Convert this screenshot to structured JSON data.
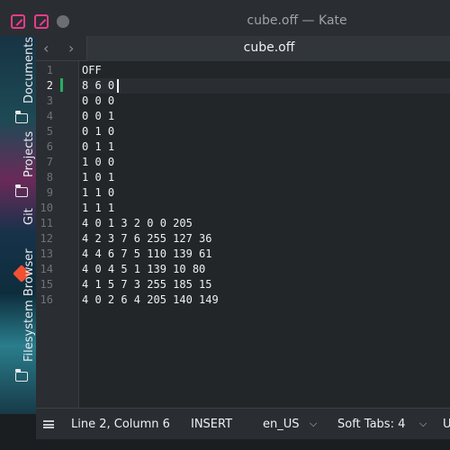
{
  "window": {
    "title": "cube.off — Kate"
  },
  "sidebar": {
    "items": [
      {
        "label": "Documents"
      },
      {
        "label": "Projects"
      },
      {
        "label": "Git"
      },
      {
        "label": "Filesystem Browser"
      }
    ]
  },
  "tabbar": {
    "back": "‹",
    "forward": "›",
    "tab_label": "cube.off"
  },
  "editor": {
    "current_line": 2,
    "line_numbers": [
      "1",
      "2",
      "3",
      "4",
      "5",
      "6",
      "7",
      "8",
      "9",
      "10",
      "11",
      "12",
      "13",
      "14",
      "15",
      "16"
    ],
    "lines": [
      "OFF",
      "8 6 0",
      "0 0 0",
      "0 0 1",
      "0 1 0",
      "0 1 1",
      "1 0 0",
      "1 0 1",
      "1 1 0",
      "1 1 1",
      "4 0 1 3 2 0 0 205",
      "4 2 3 7 6 255 127 36",
      "4 4 6 7 5 110 139 61",
      "4 0 4 5 1 139 10 80",
      "4 1 5 7 3 255 185 15",
      "4 0 2 6 4 205 140 149"
    ]
  },
  "statusbar": {
    "cursor_position": "Line 2, Column 6",
    "mode": "INSERT",
    "dictionary": "en_US",
    "indent": "Soft Tabs: 4",
    "encoding_partial": "U"
  },
  "colors": {
    "accent_pink": "#e93d8a",
    "git_orange": "#f05133",
    "modified_green": "#27ae60"
  }
}
